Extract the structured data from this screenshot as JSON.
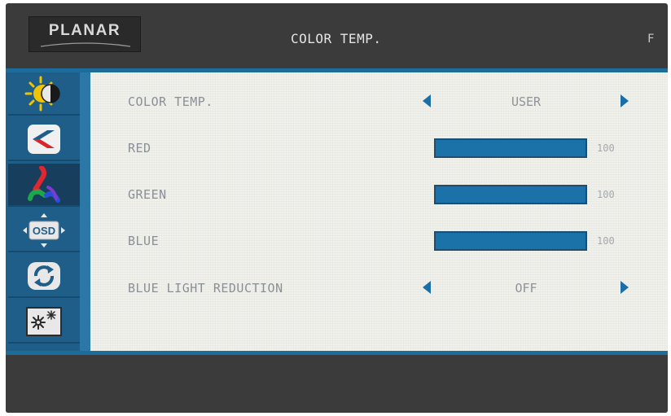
{
  "header": {
    "logo_text": "PLANAR",
    "title": "COLOR TEMP.",
    "flag": "F"
  },
  "sidebar": {
    "items": [
      {
        "icon": "brightness-contrast-icon",
        "active": false
      },
      {
        "icon": "image-adjust-icon",
        "active": false
      },
      {
        "icon": "color-icon",
        "active": true
      },
      {
        "icon": "osd-settings-icon",
        "label": "OSD",
        "active": false
      },
      {
        "icon": "reset-icon",
        "active": false
      },
      {
        "icon": "setup-icon",
        "active": false
      }
    ]
  },
  "menu": {
    "color_temp": {
      "label": "COLOR TEMP.",
      "value": "USER"
    },
    "red": {
      "label": "RED",
      "value": "100",
      "level_percent": 100
    },
    "green": {
      "label": "GREEN",
      "value": "100",
      "level_percent": 100
    },
    "blue": {
      "label": "BLUE",
      "value": "100",
      "level_percent": 100
    },
    "blue_light_reduction": {
      "label": "BLUE LIGHT REDUCTION",
      "value": "OFF"
    }
  },
  "colors": {
    "accent": "#1b72a8",
    "frame": "#1d6d9c",
    "sidebar": "#1f5e89",
    "bezel": "#3c3b3c",
    "content_bg": "#f1f1ec"
  }
}
